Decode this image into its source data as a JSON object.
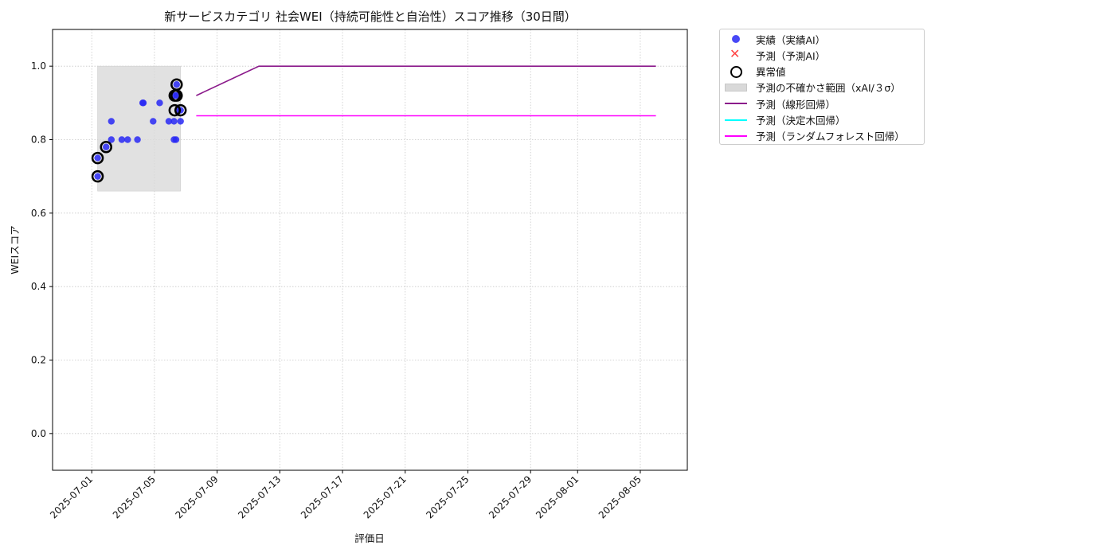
{
  "chart_data": {
    "type": "scatter",
    "title": "新サービスカテゴリ 社会WEI（持続可能性と自治性）スコア推移（30日間）",
    "xlabel": "評価日",
    "ylabel": "WEIスコア",
    "xlim": [
      "2025-06-28T12:00",
      "2025-08-08T00:00"
    ],
    "ylim": [
      -0.1,
      1.1
    ],
    "yticks": [
      0.0,
      0.2,
      0.4,
      0.6,
      0.8,
      1.0
    ],
    "ytick_labels": [
      "0.0",
      "0.2",
      "0.4",
      "0.6",
      "0.8",
      "1.0"
    ],
    "xticks": [
      "2025-07-01",
      "2025-07-05",
      "2025-07-09",
      "2025-07-13",
      "2025-07-17",
      "2025-07-21",
      "2025-07-25",
      "2025-07-29",
      "2025-08-01",
      "2025-08-05"
    ],
    "grid": true,
    "legend_position": "outside-right-top",
    "colors": {
      "actual": "#2828f5",
      "forecast_ai": "#ff4444",
      "anomaly": "#000000",
      "uncertainty": "#d9d9d9",
      "linear": "#8b1a8b",
      "tree": "#00ffff",
      "forest": "#ff00ff"
    },
    "legend": [
      {
        "key": "actual",
        "label": "実績（実績AI）",
        "marker": "dot"
      },
      {
        "key": "forecast_ai",
        "label": "予測（予測AI）",
        "marker": "x"
      },
      {
        "key": "anomaly",
        "label": "異常値",
        "marker": "ring"
      },
      {
        "key": "uncertainty",
        "label": "予測の不確かさ範囲（xAI/３σ）",
        "marker": "band"
      },
      {
        "key": "linear",
        "label": "予測（線形回帰）",
        "marker": "line"
      },
      {
        "key": "tree",
        "label": "予測（決定木回帰）",
        "marker": "line"
      },
      {
        "key": "forest",
        "label": "予測（ランダムフォレスト回帰）",
        "marker": "line"
      }
    ],
    "series": [
      {
        "key": "actual",
        "name": "実績（実績AI）",
        "points": [
          [
            "2025-07-01T09:00",
            0.75
          ],
          [
            "2025-07-01T09:00",
            0.7
          ],
          [
            "2025-07-01T22:00",
            0.78
          ],
          [
            "2025-07-02T06:00",
            0.85
          ],
          [
            "2025-07-02T06:00",
            0.8
          ],
          [
            "2025-07-02T22:00",
            0.8
          ],
          [
            "2025-07-03T07:00",
            0.8
          ],
          [
            "2025-07-03T22:00",
            0.8
          ],
          [
            "2025-07-04T06:00",
            0.9
          ],
          [
            "2025-07-04T07:00",
            0.9
          ],
          [
            "2025-07-04T22:00",
            0.85
          ],
          [
            "2025-07-05T08:00",
            0.9
          ],
          [
            "2025-07-05T22:00",
            0.85
          ],
          [
            "2025-07-06T06:00",
            0.85
          ],
          [
            "2025-07-06T06:00",
            0.8
          ],
          [
            "2025-07-06T07:00",
            0.92
          ],
          [
            "2025-07-06T09:00",
            0.8
          ],
          [
            "2025-07-06T10:00",
            0.95
          ],
          [
            "2025-07-06T10:00",
            0.92
          ],
          [
            "2025-07-06T12:00",
            0.88
          ],
          [
            "2025-07-06T16:00",
            0.85
          ],
          [
            "2025-07-06T16:00",
            0.88
          ]
        ]
      },
      {
        "key": "anomaly",
        "name": "異常値",
        "points": [
          [
            "2025-07-01T09:00",
            0.75
          ],
          [
            "2025-07-01T09:00",
            0.7
          ],
          [
            "2025-07-01T22:00",
            0.78
          ],
          [
            "2025-07-06T07:00",
            0.92
          ],
          [
            "2025-07-06T07:00",
            0.88
          ],
          [
            "2025-07-06T10:00",
            0.95
          ],
          [
            "2025-07-06T10:00",
            0.92
          ],
          [
            "2025-07-06T16:00",
            0.88
          ]
        ]
      },
      {
        "key": "uncertainty",
        "name": "予測の不確かさ範囲（xAI/３σ）",
        "x_range": [
          "2025-07-01T09:00",
          "2025-07-06T16:00"
        ],
        "y_range": [
          0.66,
          1.0
        ]
      },
      {
        "key": "linear",
        "name": "予測（線形回帰）",
        "points": [
          [
            "2025-07-07T16:00",
            0.92
          ],
          [
            "2025-07-10T16:00",
            0.98
          ],
          [
            "2025-07-11T16:00",
            1.0
          ],
          [
            "2025-08-06T00:00",
            1.0
          ]
        ]
      },
      {
        "key": "forest",
        "name": "予測（ランダムフォレスト回帰）",
        "points": [
          [
            "2025-07-07T16:00",
            0.865
          ],
          [
            "2025-08-06T00:00",
            0.865
          ]
        ]
      }
    ]
  }
}
